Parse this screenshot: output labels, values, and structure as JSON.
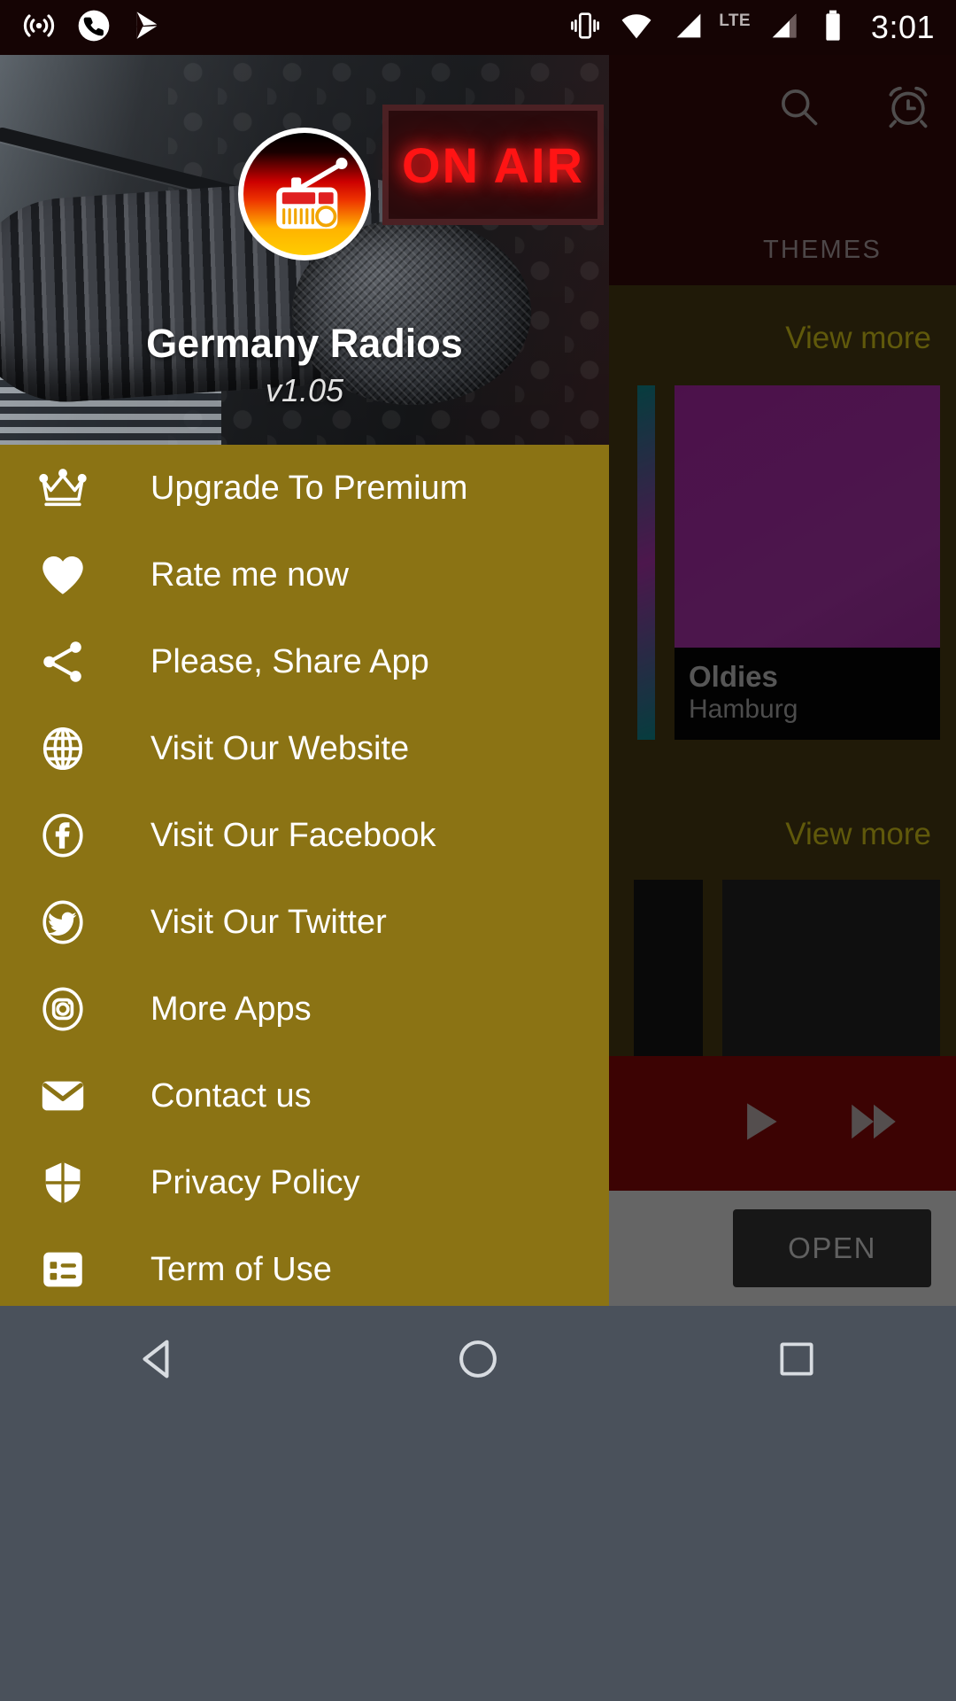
{
  "status_bar": {
    "icons": [
      "cast-icon",
      "phone-call-icon",
      "play-store-icon",
      "vibrate-icon",
      "wifi-icon",
      "signal-icon",
      "signal-2-icon",
      "battery-icon"
    ],
    "network_label": "LTE",
    "clock": "3:01"
  },
  "drawer": {
    "app_name": "Germany Radios",
    "version": "v1.05",
    "logo_icon": "radio-icon",
    "on_air_sign": "ON AIR",
    "items": [
      {
        "label": "Upgrade To Premium",
        "icon": "crown-icon"
      },
      {
        "label": "Rate me now",
        "icon": "heart-icon"
      },
      {
        "label": "Please, Share App",
        "icon": "share-icon"
      },
      {
        "label": "Visit Our Website",
        "icon": "globe-icon"
      },
      {
        "label": "Visit Our Facebook",
        "icon": "facebook-icon"
      },
      {
        "label": "Visit Our Twitter",
        "icon": "twitter-icon"
      },
      {
        "label": "More Apps",
        "icon": "instagram-icon"
      },
      {
        "label": "Contact us",
        "icon": "envelope-icon"
      },
      {
        "label": "Privacy Policy",
        "icon": "shield-icon"
      },
      {
        "label": "Term of Use",
        "icon": "list-document-icon"
      }
    ]
  },
  "app_background": {
    "toolbar": {
      "search_icon": "search-icon",
      "alarm_icon": "alarm-clock-icon"
    },
    "tabs": [
      {
        "label": "THEMES",
        "selected": false
      }
    ],
    "sections": [
      {
        "view_more_label": "View more"
      },
      {
        "view_more_label": "View more"
      }
    ],
    "cards": [
      {
        "title": "Oldies",
        "subtitle": "Hamburg",
        "color": "#8b2089"
      }
    ],
    "player": {
      "play_icon": "play-icon",
      "next_icon": "fast-forward-icon"
    },
    "ad": {
      "open_label": "OPEN"
    }
  },
  "nav_bar": {
    "back_icon": "back-triangle-icon",
    "home_icon": "home-circle-icon",
    "recents_icon": "recents-square-icon"
  },
  "colors": {
    "drawer_bg": "#8b7314",
    "accent_yellow": "#b0a215",
    "toolbar_bg": "#2b0808",
    "player_bg": "#6d0606",
    "nav_bg": "#4a515b"
  }
}
